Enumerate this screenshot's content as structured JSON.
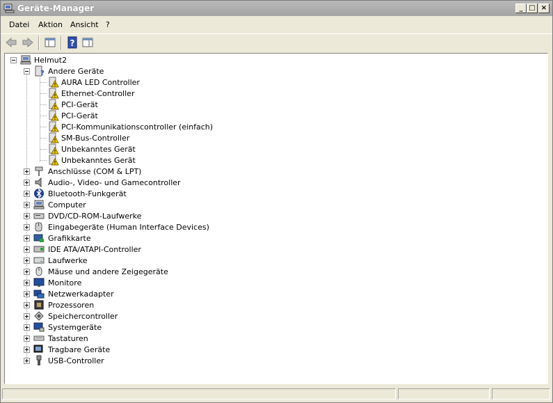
{
  "window": {
    "title": "Geräte-Manager",
    "minimize": "_",
    "maximize": "□",
    "close": "×"
  },
  "menu": {
    "items": [
      "Datei",
      "Aktion",
      "Ansicht",
      "?"
    ]
  },
  "tree": {
    "root": "Helmut2",
    "other_devices": {
      "label": "Andere Geräte",
      "children": [
        "AURA LED Controller",
        "Ethernet-Controller",
        "PCI-Gerät",
        "PCI-Gerät",
        "PCI-Kommunikationscontroller (einfach)",
        "SM-Bus-Controller",
        "Unbekanntes Gerät",
        "Unbekanntes Gerät"
      ]
    },
    "categories": [
      {
        "label": "Anschlüsse (COM & LPT)",
        "icon": "port-icon"
      },
      {
        "label": "Audio-, Video- und Gamecontroller",
        "icon": "speaker-icon"
      },
      {
        "label": "Bluetooth-Funkgerät",
        "icon": "bluetooth-icon"
      },
      {
        "label": "Computer",
        "icon": "computer-icon"
      },
      {
        "label": "DVD/CD-ROM-Laufwerke",
        "icon": "dvd-drive-icon"
      },
      {
        "label": "Eingabegeräte (Human Interface Devices)",
        "icon": "hid-icon"
      },
      {
        "label": "Grafikkarte",
        "icon": "display-adapter-icon"
      },
      {
        "label": "IDE ATA/ATAPI-Controller",
        "icon": "ide-controller-icon"
      },
      {
        "label": "Laufwerke",
        "icon": "disk-drive-icon"
      },
      {
        "label": "Mäuse und andere Zeigegeräte",
        "icon": "mouse-icon"
      },
      {
        "label": "Monitore",
        "icon": "monitor-icon"
      },
      {
        "label": "Netzwerkadapter",
        "icon": "network-adapter-icon"
      },
      {
        "label": "Prozessoren",
        "icon": "processor-icon"
      },
      {
        "label": "Speichercontroller",
        "icon": "storage-controller-icon"
      },
      {
        "label": "Systemgeräte",
        "icon": "system-device-icon"
      },
      {
        "label": "Tastaturen",
        "icon": "keyboard-icon"
      },
      {
        "label": "Tragbare Geräte",
        "icon": "portable-device-icon"
      },
      {
        "label": "USB-Controller",
        "icon": "usb-icon"
      }
    ]
  },
  "colors": {
    "warning": "#f0c800",
    "title_bar": "#a8a8a8"
  }
}
